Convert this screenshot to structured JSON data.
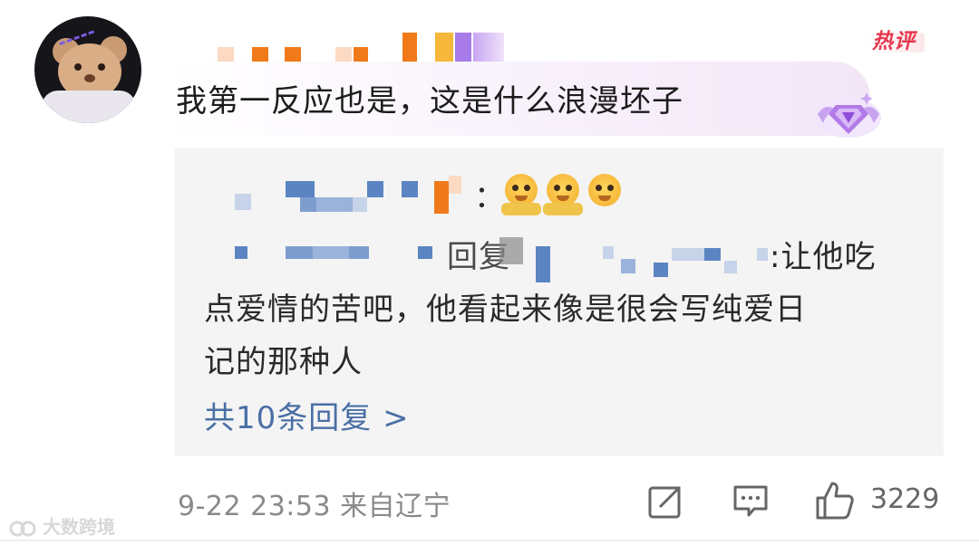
{
  "comment": {
    "hot_badge": "热评",
    "text": "我第一反应也是，这是什么浪漫坯子",
    "avatar_icon": "teddy-bear-avatar",
    "badge_icon": "diamond-member-badge"
  },
  "reply_box": {
    "reply1_suffix": "：",
    "reply1_emoji_icon": "pleading-face-emoji",
    "reply2_mid_text": "回复",
    "reply2_line1_tail": ":让他吃",
    "reply2_line2": "点爱情的苦吧，他看起来像是很会写纯爱日",
    "reply2_line3": "记的那种人",
    "more_replies": "共10条回复 >"
  },
  "footer": {
    "time_location": "9-22 23:53 来自辽宁",
    "share_icon": "share-icon",
    "comment_icon": "comment-icon",
    "like_icon": "thumbs-up-icon",
    "like_count": "3229"
  },
  "watermark": "大数跨境",
  "colors": {
    "link_blue": "#4a6fa5",
    "hot_red": "#e8384f",
    "reply_bg": "#f4f4f4",
    "mosaic_orange": "#f07a1a",
    "mosaic_purple": "#a77be8",
    "mosaic_blue": "#5b84c2"
  }
}
